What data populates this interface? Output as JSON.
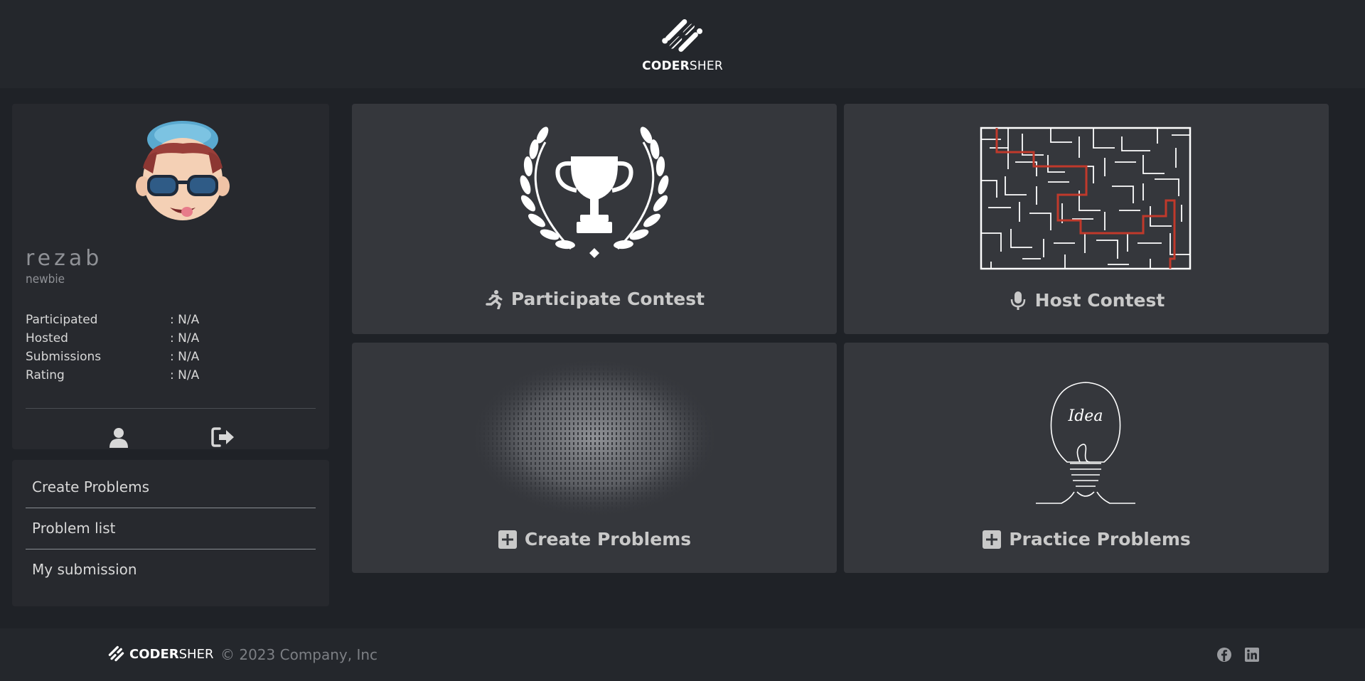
{
  "header": {
    "logo_bold": "CODER",
    "logo_light": "SHER"
  },
  "profile": {
    "username": "rezab",
    "rank": "newbie",
    "stats": [
      {
        "label": "Participated",
        "value": ": N/A"
      },
      {
        "label": "Hosted",
        "value": ": N/A"
      },
      {
        "label": "Submissions",
        "value": ": N/A"
      },
      {
        "label": "Rating",
        "value": ": N/A"
      }
    ],
    "actions": {
      "profile_icon": "user-icon",
      "logout_icon": "sign-out-icon"
    }
  },
  "menu": {
    "items": [
      {
        "label": "Create Problems"
      },
      {
        "label": "Problem list"
      },
      {
        "label": "My submission"
      }
    ]
  },
  "tiles": [
    {
      "label": "Participate Contest",
      "icon": "running-person-icon",
      "art": "trophy-laurel"
    },
    {
      "label": "Host Contest",
      "icon": "microphone-icon",
      "art": "maze"
    },
    {
      "label": "Create Problems",
      "icon": "plus-square-icon",
      "art": "binary-cloud"
    },
    {
      "label": "Practice Problems",
      "icon": "plus-square-icon",
      "art": "idea-lightbulb",
      "art_text": "Idea"
    }
  ],
  "footer": {
    "logo_bold": "CODER",
    "logo_light": "SHER",
    "copyright": "© 2023 Company, Inc",
    "social": [
      "facebook-icon",
      "linkedin-icon"
    ]
  },
  "colors": {
    "background": "#1f2227",
    "panel": "#27292e",
    "tile": "#35373c",
    "maze_path": "#c0392b"
  }
}
